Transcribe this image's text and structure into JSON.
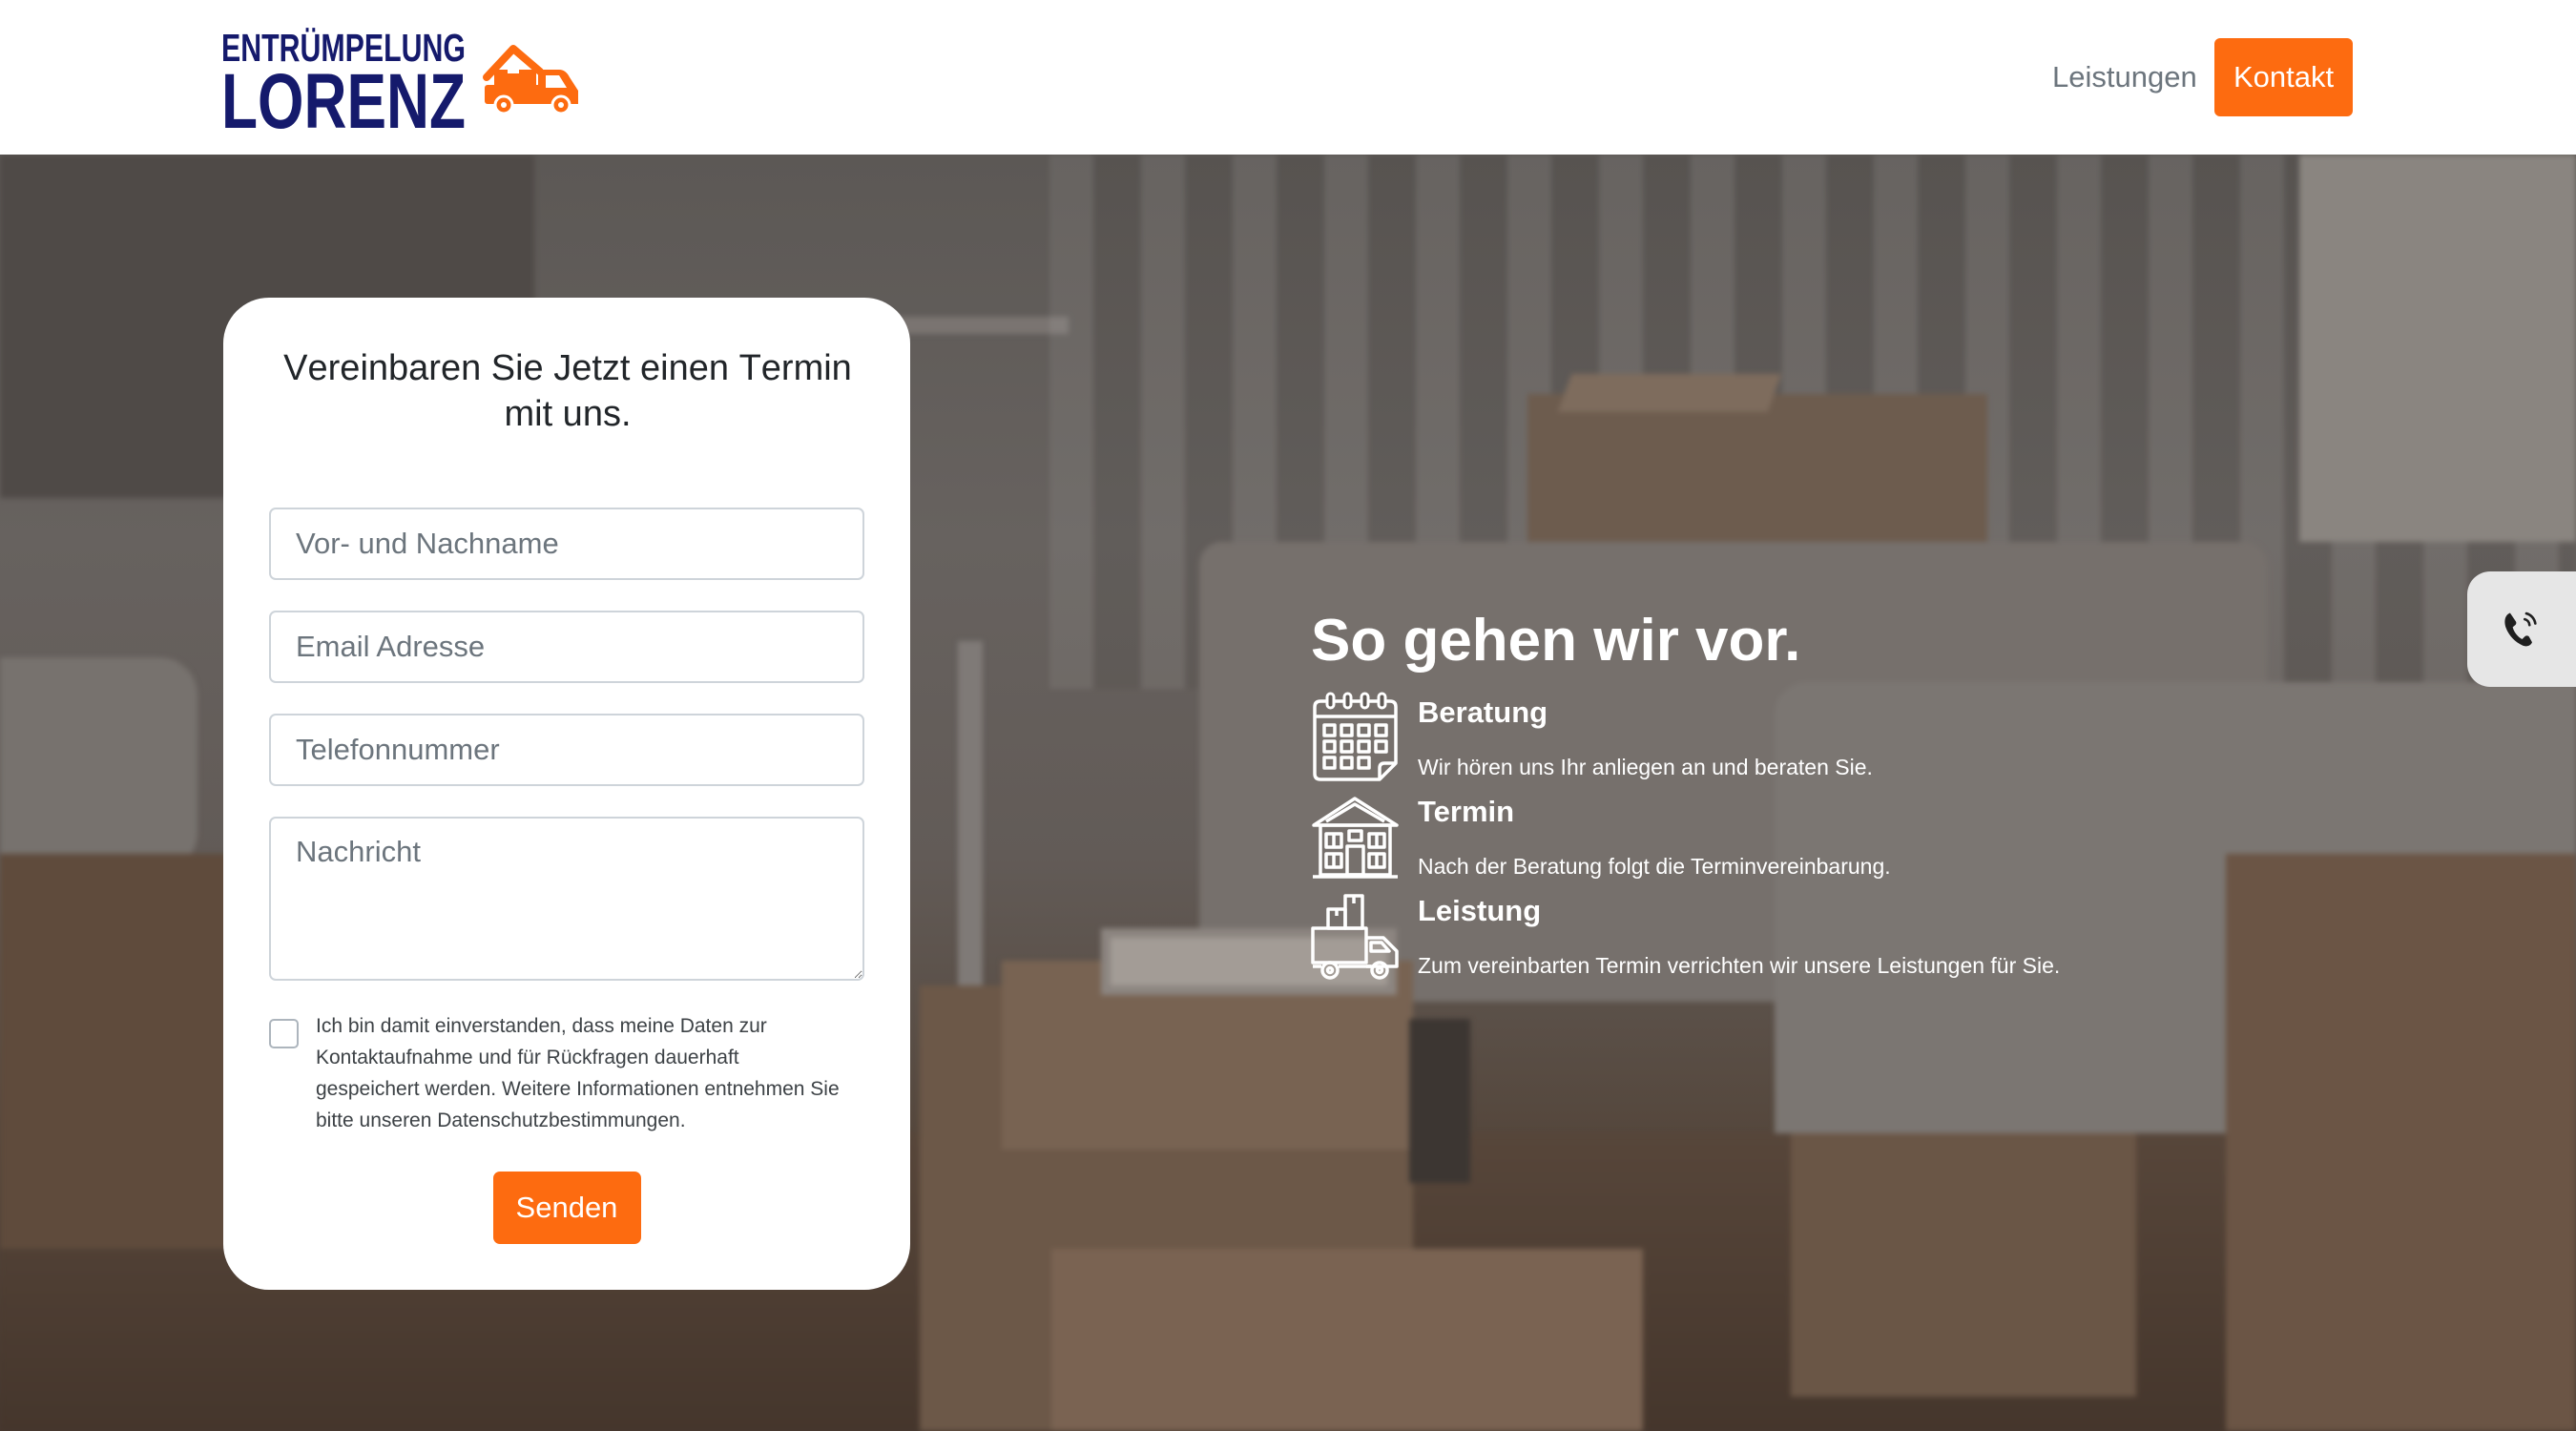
{
  "brand": {
    "line1": "ENTRÜMPELUNG",
    "line2": "LORENZ",
    "icon": "moving-truck-house-icon"
  },
  "nav": {
    "items": [
      {
        "label": "Leistungen"
      }
    ],
    "cta": "Kontakt"
  },
  "colors": {
    "accent": "#fd6b10",
    "brand_navy": "#151a6c",
    "header_bg": "#ffffff",
    "card_bg": "#ffffff",
    "phone_widget_bg": "#e6e6e6"
  },
  "form": {
    "title": "Vereinbaren Sie Jetzt einen Termin mit uns.",
    "fields": {
      "name": {
        "placeholder": "Vor- und Nachname",
        "value": ""
      },
      "email": {
        "placeholder": "Email Adresse",
        "value": ""
      },
      "phone": {
        "placeholder": "Telefonnummer",
        "value": ""
      },
      "message": {
        "placeholder": "Nachricht",
        "value": ""
      }
    },
    "consent": {
      "checked": false,
      "text": "Ich bin damit einverstanden, dass meine Daten zur Kontaktaufnahme und für Rückfragen dauerhaft gespeichert werden. Weitere Informationen entnehmen Sie bitte unseren Datenschutzbestimmungen."
    },
    "submit": "Senden"
  },
  "process": {
    "heading": "So gehen wir vor.",
    "steps": [
      {
        "title": "Beratung",
        "text": "Wir hören uns Ihr anliegen an und beraten Sie.",
        "icon": "calendar-icon"
      },
      {
        "title": "Termin",
        "text": "Nach der Beratung folgt die Terminvereinbarung.",
        "icon": "house-icon"
      },
      {
        "title": "Leistung",
        "text": "Zum vereinbarten Termin verrichten wir unsere Leistungen für Sie.",
        "icon": "delivery-truck-icon"
      }
    ]
  },
  "phone_widget": {
    "icon": "phone-ringing-icon"
  }
}
